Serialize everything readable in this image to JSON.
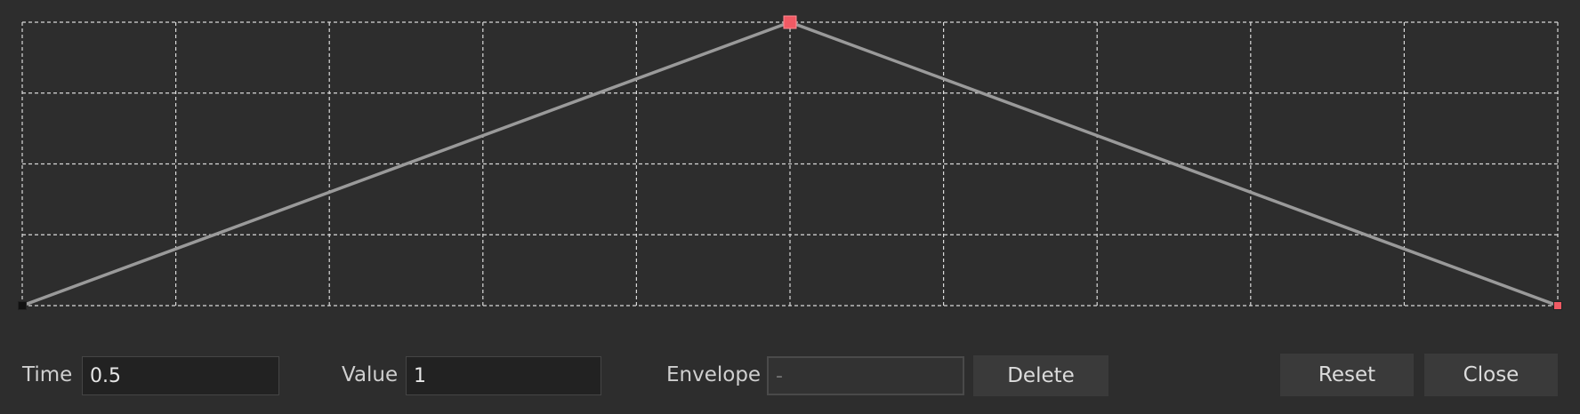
{
  "envelope_editor": {
    "grid": {
      "columns": 10,
      "rows": 4,
      "line_color": "#d9d9d9"
    },
    "curve": {
      "color": "#9a9a9a"
    },
    "points": [
      {
        "time": 0,
        "value": 0,
        "color": "#111111",
        "state": "normal"
      },
      {
        "time": 0.5,
        "value": 1,
        "color": "#f05a64",
        "state": "selected"
      },
      {
        "time": 1,
        "value": 0,
        "color": "#f05a64",
        "state": "normal"
      }
    ],
    "colors": {
      "background": "#2d2d2d",
      "selected_point": "#f05a64"
    }
  },
  "controls": {
    "time_label": "Time",
    "time_value": "0.5",
    "value_label": "Value",
    "value_value": "1",
    "envelope_label": "Envelope",
    "envelope_placeholder": "-",
    "delete_label": "Delete",
    "reset_label": "Reset",
    "close_label": "Close"
  }
}
